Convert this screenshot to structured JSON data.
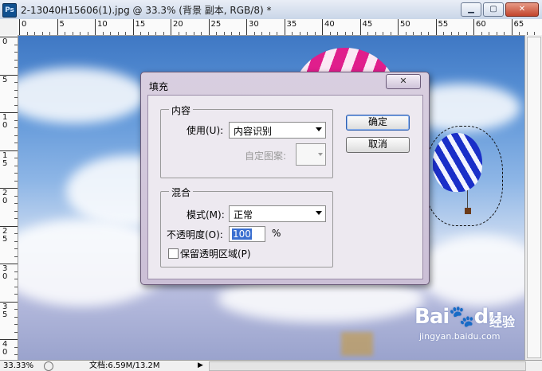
{
  "window": {
    "app_logo": "Ps",
    "title": "2-13040H15606(1).jpg @ 33.3% (背景 副本, RGB/8) *",
    "buttons": {
      "minimize": "minimize-icon",
      "maximize": "maximize-icon",
      "close": "close-icon"
    }
  },
  "rulers": {
    "top_labels": [
      "0",
      "5",
      "10",
      "15",
      "20",
      "25",
      "30",
      "35",
      "40",
      "45",
      "50",
      "55",
      "60",
      "65"
    ],
    "left_labels": [
      "0",
      "5",
      "1\n0",
      "1\n5",
      "2\n0",
      "2\n5",
      "3\n0",
      "3\n5",
      "4\n0"
    ]
  },
  "dialog": {
    "title": "填充",
    "content_group": {
      "title": "内容",
      "use_label": "使用(U):",
      "use_value": "内容识别",
      "pattern_label": "自定图案:"
    },
    "blend_group": {
      "title": "混合",
      "mode_label": "模式(M):",
      "mode_value": "正常",
      "opacity_label": "不透明度(O):",
      "opacity_value": "100",
      "opacity_unit": "%",
      "preserve_label": "保留透明区域(P)"
    },
    "ok_label": "确定",
    "cancel_label": "取消"
  },
  "status": {
    "zoom": "33.33%",
    "doc_info": "文档:6.59M/13.2M"
  },
  "watermark": {
    "brand": "Bai",
    "brand2": "du",
    "sub": "经验",
    "url": "jingyan.baidu.com"
  }
}
